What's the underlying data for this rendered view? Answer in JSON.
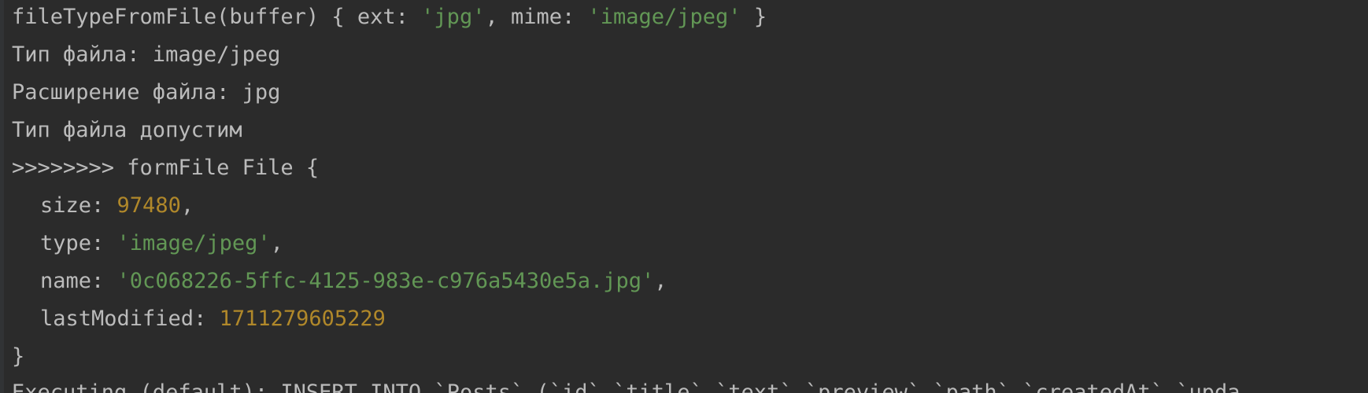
{
  "colors": {
    "background": "#2b2b2b",
    "text": "#bbbbbb",
    "string": "#629755",
    "number": "#b0882a"
  },
  "console": {
    "line1": {
      "prefix": "fileTypeFromFile(buffer) { ext: ",
      "ext": "'jpg'",
      "mid": ", mime: ",
      "mime": "'image/jpeg'",
      "suffix": " }"
    },
    "line2": "Тип файла: image/jpeg",
    "line3": "Расширение файла: jpg",
    "line4": "Тип файла допустим",
    "line5": ">>>>>>>> formFile File {",
    "size": {
      "key": "size: ",
      "value": "97480",
      "comma": ","
    },
    "type": {
      "key": "type: ",
      "value": "'image/jpeg'",
      "comma": ","
    },
    "name": {
      "key": "name: ",
      "value": "'0c068226-5ffc-4125-983e-c976a5430e5a.jpg'",
      "comma": ","
    },
    "lastModified": {
      "key": "lastModified: ",
      "value": "1711279605229"
    },
    "closing_brace": "}",
    "line_last": "Executing (default): INSERT INTO `Posts` (`id`,`title`,`text`,`preview`,`path`,`createdAt`,`upda"
  }
}
